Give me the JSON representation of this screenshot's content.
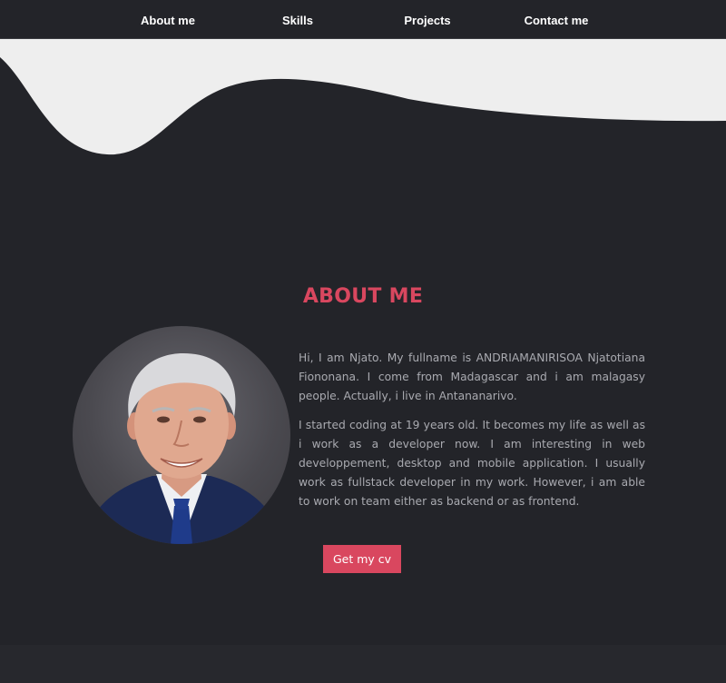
{
  "nav": {
    "items": [
      {
        "label": "About me"
      },
      {
        "label": "Skills"
      },
      {
        "label": "Projects"
      },
      {
        "label": "Contact me"
      }
    ]
  },
  "about": {
    "title": "ABOUT ME",
    "paragraphs": [
      "Hi, I am Njato. My fullname is ANDRIAMANIRISOA Njatotiana Fiononana. I come from Madagascar and i am malagasy people. Actually, i live in Antananarivo.",
      "I started coding at 19 years old. It becomes my life as well as i work as a developer now. I am interesting in web developpement, desktop and mobile application. I usually work as fullstack developer in my work. However, i am able to work on team either as backend or as frontend."
    ],
    "cv_button_label": "Get my cv"
  },
  "colors": {
    "background": "#232429",
    "accent": "#d9475f",
    "wave": "#eeeeee",
    "text": "#a9aab0"
  }
}
